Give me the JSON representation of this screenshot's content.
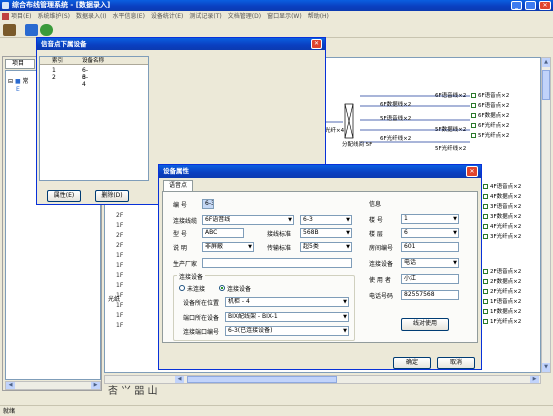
{
  "app": {
    "title": "综合布线管理系统 - [数据录入]",
    "menu": [
      "项目(E)",
      "系统维护(S)",
      "数据录入(I)",
      "水平信息(E)",
      "设备统计(E)",
      "测试记录(T)",
      "文档管理(D)",
      "窗口显示(W)",
      "帮助(H)"
    ],
    "status": "就绪",
    "colors": {
      "title_blue": "#0a4fd0",
      "dialog_face": "#ece9d8",
      "diagram_bg": "#ffffff"
    }
  },
  "tree_panel": {
    "tab": "项目",
    "rows_top": [
      "常",
      "E"
    ],
    "rows": [
      "2F",
      "1F",
      "2F",
      "2F",
      "1F",
      "1F",
      "1F",
      "1F",
      "1F",
      "1F",
      "1F",
      "1F"
    ],
    "group_label": "光纸"
  },
  "info_dialog": {
    "title": "信音点下属设备",
    "columns": [
      "索引",
      "设备名称"
    ],
    "rows": [
      {
        "index": "1",
        "name": "6-3"
      },
      {
        "index": "2",
        "name": "6-4"
      }
    ],
    "buttons": {
      "attributes": "属性(E)",
      "delete": "删除(D)"
    }
  },
  "diagram": {
    "outlets": [
      "6F语音点×2",
      "6F语音点×2",
      "6F数据点×2",
      "6F光纤点×2",
      "5F光纤点×2"
    ],
    "outlets_lower": [
      "4F语音点×2",
      "4F数据点×2",
      "3F语音点×2",
      "3F数据点×2",
      "4F光纤点×2",
      "3F光纤点×2"
    ],
    "outlets_bottom": [
      "2F语音点×2",
      "2F数据点×2",
      "2F光纤点×2",
      "1F语音点×2",
      "1F数据点×2",
      "1F光纤点×2"
    ],
    "line_labels": [
      "6F语音线×2",
      "6F数据线×2",
      "5F语音线×2",
      "5F数据线×2",
      "6F光纤线×2",
      "5F光纤线×2"
    ],
    "trunk_label": "光纤×4",
    "dist_label": "分配线间 5F"
  },
  "attr_dialog": {
    "title": "设备属性",
    "tab": "语音点",
    "labels": {
      "number": "编 号",
      "cable": "连接线缆",
      "type": "型 号",
      "cable_std": "接线标准",
      "desc": "说 明",
      "trans_std": "传输标准",
      "maker": "生产厂家",
      "conn_group": "连接设备",
      "not_conn": "未连接",
      "conn": "连接设备",
      "dev_pos": "设备所在位置",
      "port_dev": "端口所在设备",
      "port_no": "连接端口编号",
      "info_group": "信息",
      "building": "楼 号",
      "floor": "楼 层",
      "room": "房间编号",
      "conn_dev": "连接设备",
      "user": "使 用 者",
      "phone": "电话号码"
    },
    "values": {
      "number": "6-3",
      "cable": "6F语音线",
      "cable_right": "6-3",
      "type": "ABC",
      "cable_std": "568B",
      "desc": "非屏蔽",
      "trans_std": "超5类",
      "maker": "",
      "dev_pos": "机柜 - 4",
      "port_dev": "BIX配线架 - BIX-1",
      "port_no": "6-3(已连接设备)",
      "building": "1",
      "floor": "6",
      "room": "601",
      "conn_dev": "电话",
      "user": "小江",
      "phone": "82557568"
    },
    "buttons": {
      "use": "线对使用",
      "ok": "确定",
      "cancel": "取消"
    }
  },
  "bottom_toolbar_glyphs": "㕻 ⺍ 㗊 ⼭"
}
